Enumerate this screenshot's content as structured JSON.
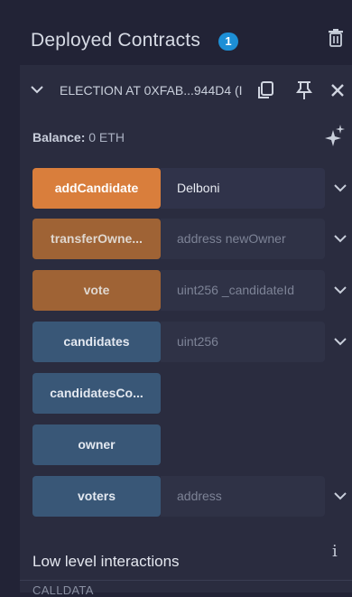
{
  "header": {
    "title": "Deployed Contracts",
    "count_badge": "1"
  },
  "contract": {
    "name": "ELECTION AT 0XFAB...944D4 (I",
    "balance_label": "Balance:",
    "balance_value": "0 ETH"
  },
  "functions": [
    {
      "label": "addCandidate",
      "arg_value": "Delboni",
      "arg_placeholder": "",
      "style": "orange",
      "has_input": true
    },
    {
      "label": "transferOwne...",
      "arg_value": "",
      "arg_placeholder": "address newOwner",
      "style": "brown",
      "has_input": true
    },
    {
      "label": "vote",
      "arg_value": "",
      "arg_placeholder": "uint256 _candidateId",
      "style": "brown",
      "has_input": true
    },
    {
      "label": "candidates",
      "arg_value": "",
      "arg_placeholder": "uint256",
      "style": "blue",
      "has_input": true
    },
    {
      "label": "candidatesCo...",
      "style": "blue",
      "has_input": false
    },
    {
      "label": "owner",
      "style": "blue",
      "has_input": false
    },
    {
      "label": "voters",
      "arg_value": "",
      "arg_placeholder": "address",
      "style": "blue",
      "has_input": true
    }
  ],
  "low_level": {
    "title": "Low level interactions",
    "info": "i",
    "calldata_label": "CALLDATA"
  },
  "colors": {
    "background": "#222336",
    "panel": "#2a2c3f",
    "orange": "#d97e3c",
    "brown": "#9f6335",
    "blue": "#395777",
    "badge": "#1d8fd6"
  }
}
